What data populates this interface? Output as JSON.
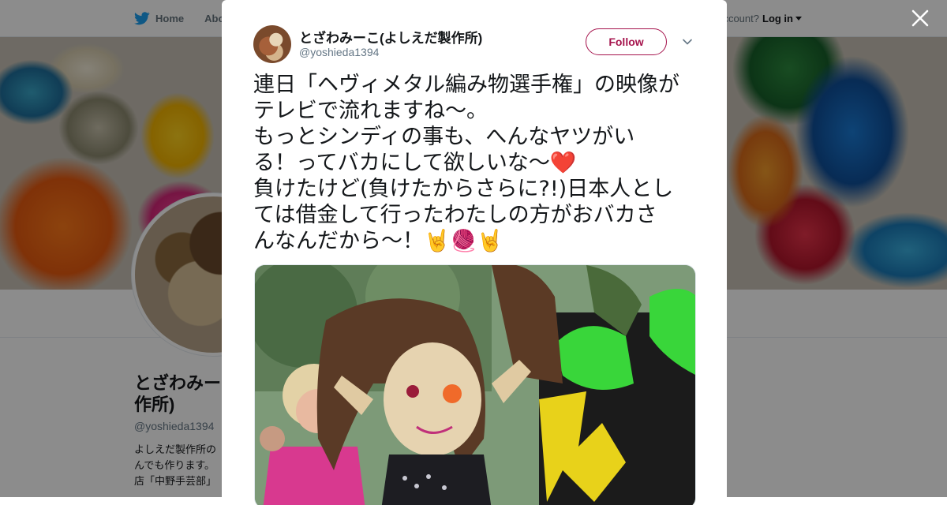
{
  "nav": {
    "home_label": "Home",
    "about_label": "Abo",
    "account_text": "ccount?",
    "login_label": "Log in"
  },
  "profile": {
    "name": "とざわみーこ(よしえだ製作所)",
    "name_visible": "とざわみー\n作所)",
    "handle": "@yoshieda1394",
    "bio_visible": "よしえだ製作所の\nんでも作ります。\n店「中野手芸部」"
  },
  "tweet": {
    "author_name": "とざわみーこ(よしえだ製作所)",
    "author_handle": "@yoshieda1394",
    "follow_label": "Follow",
    "text": "連日「ヘヴィメタル編み物選手権」の映像が\nテレビで流れますね～。\nもっとシンディの事も、へんなヤツがい\nる！ってバカにして欲しいな～❤️\n負けたけど(負けたからさらに?!)日本人とし\nては借金して行ったわたしの方がおバカさ\nんなんだから～！🤘🧶🤘"
  },
  "icons": {
    "nav_bird": "twitter-bird-icon",
    "caret": "caret-down-icon",
    "close": "close-icon",
    "more": "chevron-down-icon"
  },
  "colors": {
    "accent": "#a5134c",
    "nav_blue": "#1da1f2",
    "overlay": "rgba(0,0,0,0.45)"
  }
}
